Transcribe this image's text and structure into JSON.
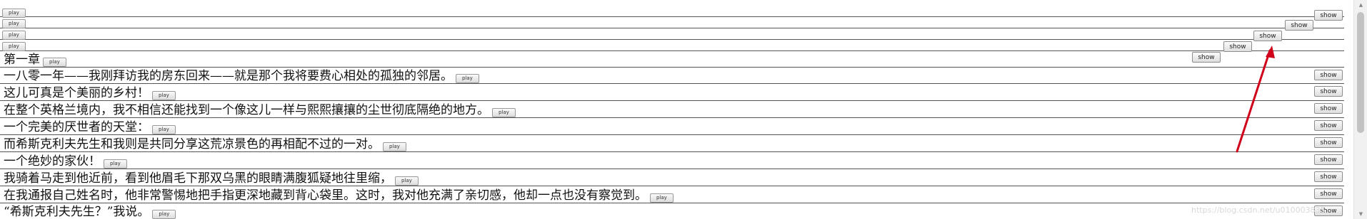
{
  "buttons": {
    "play_label": "play",
    "show_label": "show"
  },
  "lines": [
    {
      "text": ""
    },
    {
      "text": ""
    },
    {
      "text": ""
    },
    {
      "text": ""
    },
    {
      "text": "第一章"
    },
    {
      "text": "一八零一年——我刚拜访我的房东回来——就是那个我将要费心相处的孤独的邻居。"
    },
    {
      "text": "这儿可真是个美丽的乡村！"
    },
    {
      "text": "在整个英格兰境内，我不相信还能找到一个像这儿一样与熙熙攘攘的尘世彻底隔绝的地方。"
    },
    {
      "text": "一个完美的厌世者的天堂："
    },
    {
      "text": "而希斯克利夫先生和我则是共同分享这荒凉景色的再相配不过的一对。"
    },
    {
      "text": "一个绝妙的家伙！"
    },
    {
      "text": "我骑着马走到他近前，看到他眉毛下那双乌黑的眼睛满腹狐疑地往里缩，"
    },
    {
      "text": "在我通报自己姓名时，他非常警惕地把手指更深地藏到背心袋里。这时，我对他充满了亲切感，他却一点也没有察觉到。"
    },
    {
      "text": "“希斯克利夫先生？”我说。"
    }
  ],
  "watermark": "https://blog.csdn.net/u010003835",
  "annotation": {
    "arrow_color": "#d0021b"
  },
  "colors": {
    "row_border": "#555555",
    "button_bg": "#e4e4e4"
  }
}
